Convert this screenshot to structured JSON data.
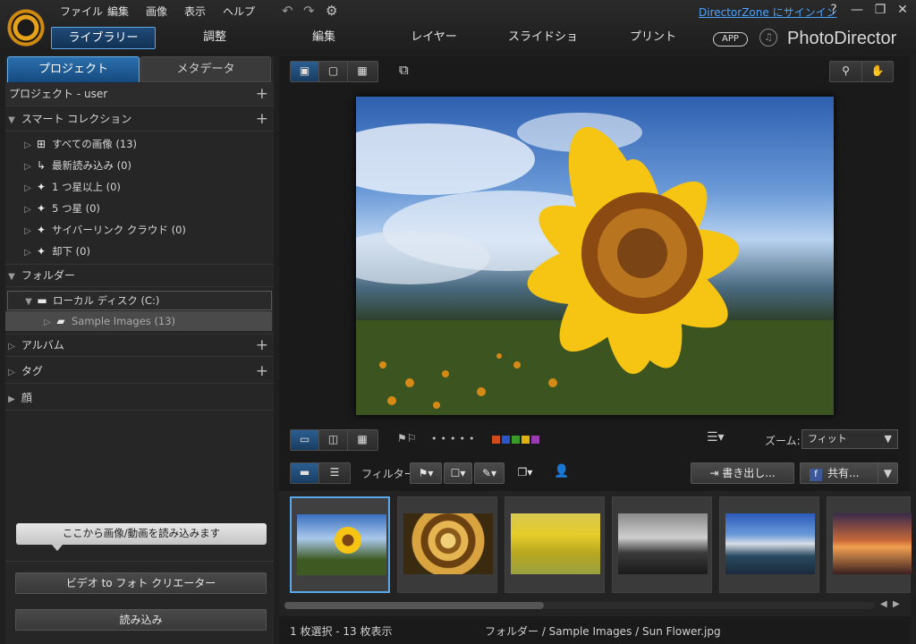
{
  "menu": [
    "ファイル",
    "編集",
    "画像",
    "表示",
    "ヘルプ"
  ],
  "header": {
    "signin": "DirectorZone にサインイン",
    "help": "?",
    "app_badge": "APP",
    "brand": "PhotoDirector",
    "tabs": [
      "ライブラリー",
      "調整",
      "編集",
      "レイヤー",
      "スライドショー",
      "プリント"
    ]
  },
  "left": {
    "tabs": [
      "プロジェクト",
      "メタデータ"
    ],
    "project": "プロジェクト - user",
    "smart": "スマート コレクション",
    "smart_items": [
      "すべての画像 (13)",
      "最新読み込み (0)",
      "1 つ星以上 (0)",
      "5 つ星 (0)",
      "サイバーリンク クラウド (0)",
      "却下 (0)"
    ],
    "folder": "フォルダー",
    "disk": "ローカル ディスク (C:)",
    "sample": "Sample Images (13)",
    "album": "アルバム",
    "tag": "タグ",
    "face": "顔",
    "hint": "ここから画像/動画を読み込みます",
    "video_btn": "ビデオ to フォト クリエーター",
    "import_btn": "読み込み"
  },
  "toolbar": {
    "zoom_label": "ズーム:",
    "zoom_value": "フィット",
    "filter_label": "フィルター:",
    "export": "書き出し...",
    "share": "共有...",
    "colors": [
      "#d04a1a",
      "#2a55c8",
      "#3a9a2a",
      "#e0b010",
      "#9a3ab0"
    ]
  },
  "status": {
    "count": "1 枚選択 - 13 枚表示",
    "path": "フォルダー / Sample Images / Sun Flower.jpg"
  }
}
